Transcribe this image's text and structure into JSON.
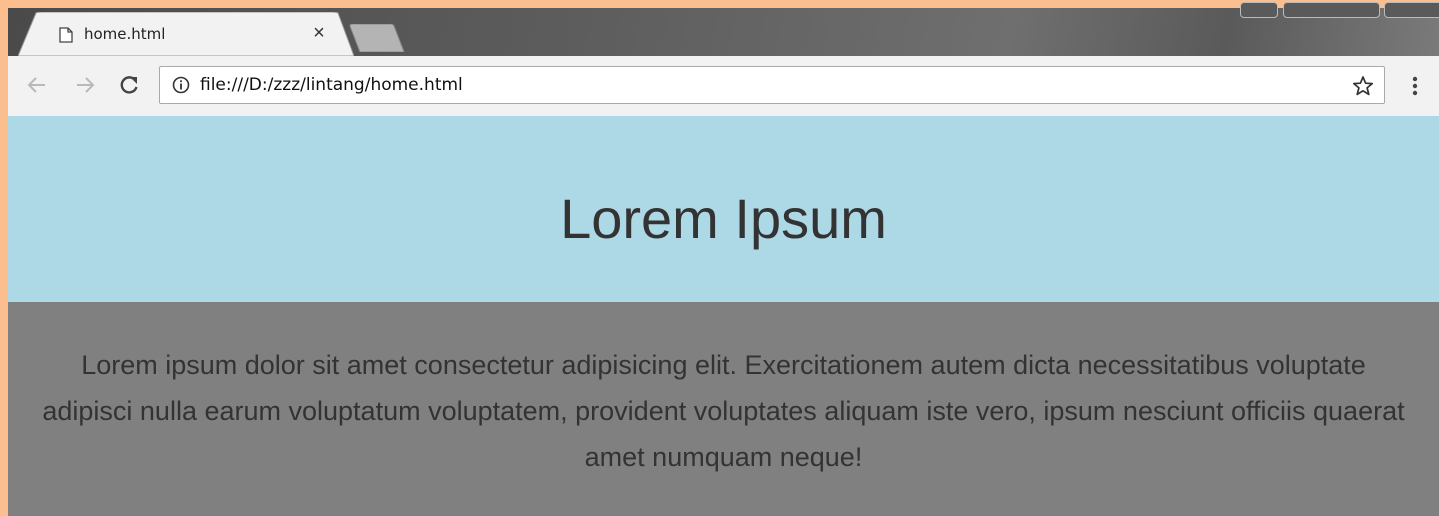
{
  "tab": {
    "title": "home.html",
    "close_label": "×",
    "favicon": "page-icon"
  },
  "toolbar": {
    "back_icon": "back-arrow-icon",
    "forward_icon": "forward-arrow-icon",
    "reload_icon": "reload-icon",
    "url": "file:///D:/zzz/lintang/home.html",
    "info_icon": "info-icon",
    "bookmark_icon": "star-icon",
    "menu_icon": "vertical-dots-icon"
  },
  "page": {
    "heading": "Lorem Ipsum",
    "paragraph": "Lorem ipsum dolor sit amet consectetur adipisicing elit. Exercitationem autem dicta necessitatibus voluptate adipisci nulla earum voluptatum voluptatem, provident voluptates aliquam iste vero, ipsum nesciunt officiis quaerat amet numquam neque!"
  },
  "colors": {
    "desktop_background": "#fbbf8f",
    "header_background": "#add8e6",
    "body_background": "#808080",
    "text": "#333333"
  }
}
